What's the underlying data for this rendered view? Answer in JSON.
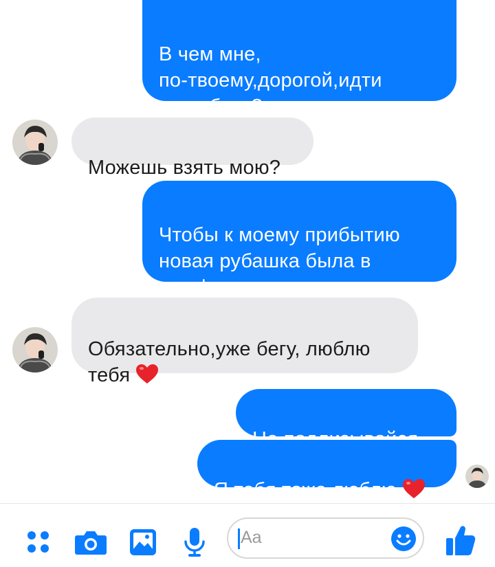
{
  "conversation": {
    "messages": [
      {
        "direction": "outgoing",
        "text": "В чем мне,\nпо-твоему,дорогой,идти\nна работу?"
      },
      {
        "direction": "incoming",
        "text": "Можешь взять мою?"
      },
      {
        "direction": "outgoing",
        "text": "Чтобы к моему прибытию\nновая рубашка была в\nшкафу."
      },
      {
        "direction": "incoming",
        "text": "Обязательно,уже бегу, люблю\nтебя",
        "emoji": "heart"
      },
      {
        "direction": "outgoing",
        "text": "Не подлизывайся"
      },
      {
        "direction": "outgoing",
        "text": "Я тебя тоже люблю",
        "emoji": "heart"
      }
    ]
  },
  "composer": {
    "placeholder": "Aa"
  },
  "toolbar": {
    "icons": [
      "apps-icon",
      "camera-icon",
      "gallery-icon",
      "microphone-icon",
      "emoji-icon",
      "thumbs-up-icon"
    ]
  },
  "colors": {
    "outgoing_bubble": "#0a7cff",
    "incoming_bubble": "#e9e9eb",
    "accent": "#0a7cff"
  }
}
